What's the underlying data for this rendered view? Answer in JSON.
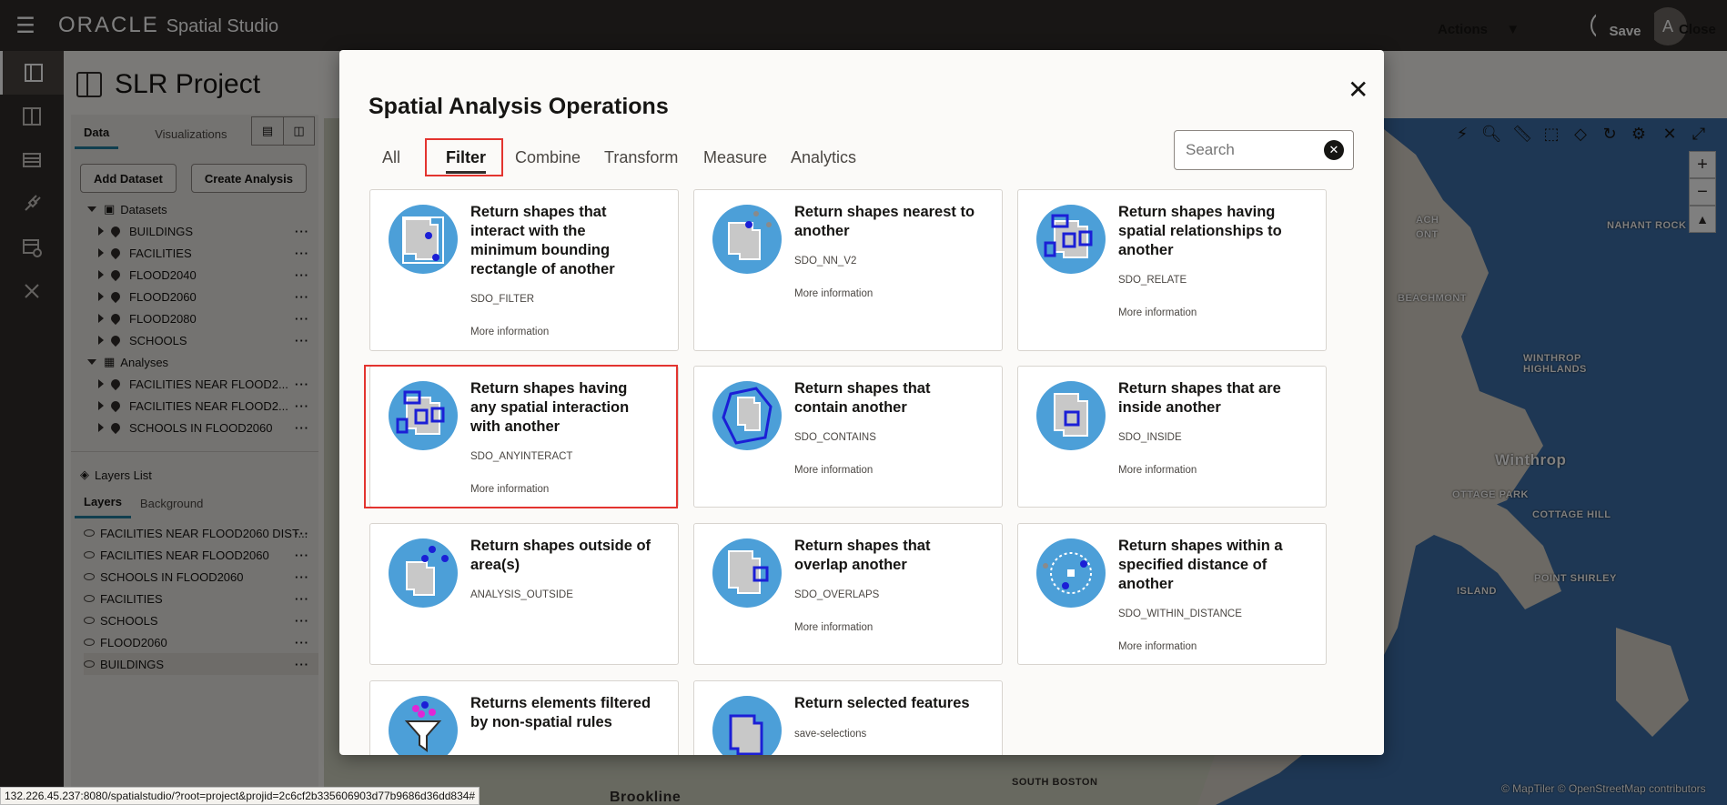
{
  "topbar": {
    "brand": "ORACLE",
    "product": "Spatial Studio",
    "help": "?",
    "avatar": "A"
  },
  "project": {
    "title": "SLR Project",
    "actions": "Actions",
    "save": "Save",
    "close": "Close"
  },
  "data_panel": {
    "tabs": [
      "Data",
      "Visualizations"
    ],
    "add_dataset": "Add Dataset",
    "create_analysis": "Create Analysis",
    "datasets_label": "Datasets",
    "datasets": [
      "BUILDINGS",
      "FACILITIES",
      "FLOOD2040",
      "FLOOD2060",
      "FLOOD2080",
      "SCHOOLS"
    ],
    "analyses_label": "Analyses",
    "analyses": [
      "FACILITIES NEAR FLOOD2...",
      "FACILITIES NEAR FLOOD2...",
      "SCHOOLS IN FLOOD2060"
    ],
    "layers_list_label": "Layers List",
    "layer_tabs": [
      "Layers",
      "Background"
    ],
    "layers": [
      "FACILITIES NEAR FLOOD2060 DIST...",
      "FACILITIES NEAR FLOOD2060",
      "SCHOOLS IN FLOOD2060",
      "FACILITIES",
      "SCHOOLS",
      "FLOOD2060",
      "BUILDINGS"
    ],
    "more": "···"
  },
  "map": {
    "labels": [
      "ACH",
      "ONT",
      "NAHANT ROCK",
      "BEACHMONT",
      "WINTHROP HIGHLANDS",
      "Winthrop",
      "OTTAGE PARK",
      "COTTAGE HILL",
      "POINT SHIRLEY",
      "ISLAND",
      "Brookline",
      "SOUTH BOSTON"
    ],
    "attribution": "© MapTiler  © OpenStreetMap contributors",
    "scale_left": "2",
    "scale_bottom": "30"
  },
  "modal": {
    "title": "Spatial Analysis Operations",
    "close": "✕",
    "tabs": [
      "All",
      "Filter",
      "Combine",
      "Transform",
      "Measure",
      "Analytics"
    ],
    "active_tab": "Filter",
    "search_placeholder": "Search",
    "more_info": "More information",
    "cards": [
      {
        "title": "Return shapes that interact with the minimum bounding rectangle of another",
        "op": "SDO_FILTER"
      },
      {
        "title": "Return shapes nearest to another",
        "op": "SDO_NN_V2"
      },
      {
        "title": "Return shapes having spatial relationships to another",
        "op": "SDO_RELATE"
      },
      {
        "title": "Return shapes having any spatial interaction with another",
        "op": "SDO_ANYINTERACT"
      },
      {
        "title": "Return shapes that contain another",
        "op": "SDO_CONTAINS"
      },
      {
        "title": "Return shapes that are inside another",
        "op": "SDO_INSIDE"
      },
      {
        "title": "Return shapes outside of area(s)",
        "op": "ANALYSIS_OUTSIDE"
      },
      {
        "title": "Return shapes that overlap another",
        "op": "SDO_OVERLAPS"
      },
      {
        "title": "Return shapes within a specified distance of another",
        "op": "SDO_WITHIN_DISTANCE"
      },
      {
        "title": "Returns elements filtered by non-spatial rules",
        "op": ""
      },
      {
        "title": "Return selected features",
        "op": "save-selections"
      }
    ]
  },
  "status": {
    "url": "132.226.45.237:8080/spatialstudio/?root=project&projid=2c6cf2b335606903d77b9686d36dd834#"
  },
  "colors": {
    "topbar": "#312d2a",
    "icon_bg": "#4c9fd8",
    "highlight": "#e3342f",
    "shape_stroke": "#1b1fd6"
  }
}
